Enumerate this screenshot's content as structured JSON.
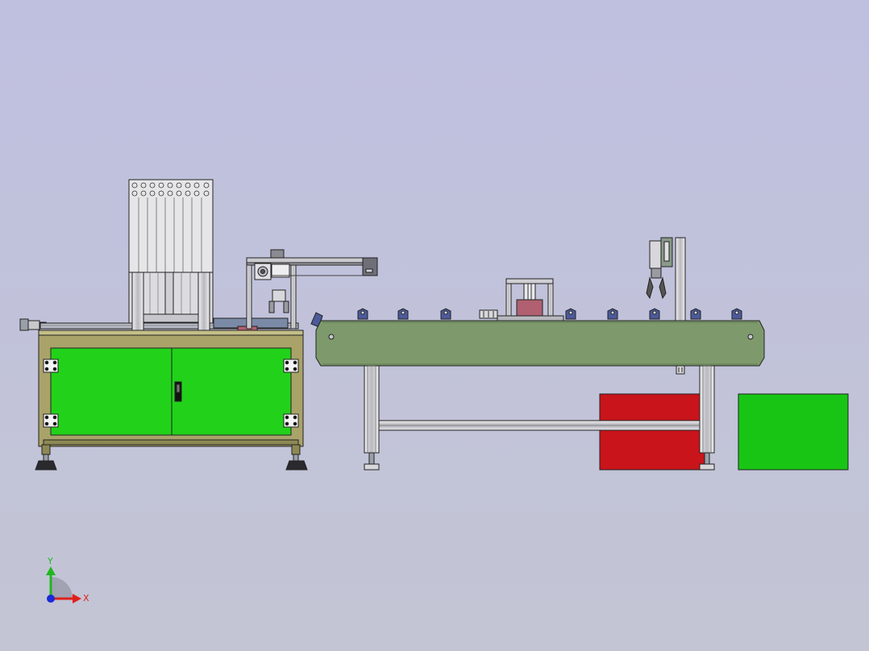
{
  "view": {
    "background_top": "#bfc0e0",
    "background_bottom": "#c3c5d4"
  },
  "triad": {
    "x_label": "X",
    "y_label": "Y",
    "x_color": "#e0201a",
    "y_color": "#1fb81f",
    "z_color": "#1a2ad8"
  },
  "colors": {
    "frame_olive": "#a9a36a",
    "cabinet_green": "#22d21a",
    "conveyor_green": "#7e9a6c",
    "bin_red": "#c8141a",
    "bin_green": "#18c514",
    "aluminum": "#d8d8dc",
    "nut_blue": "#4c5a9a",
    "magazine_gray": "#e6e6e8",
    "part_red": "#b06070"
  }
}
